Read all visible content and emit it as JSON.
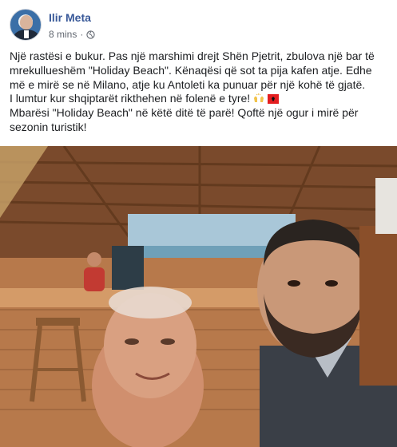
{
  "post": {
    "author": "Ilir Meta",
    "time": "8 mins",
    "separator": "·",
    "privacy_icon": "globe-icon",
    "paragraphs": [
      "Një rastësi e bukur. Pas një marshimi drejt Shën Pjetrit, zbulova një bar të mrekullueshëm \"Holiday Beach\". Kënaqësi që sot ta pija kafen atje. Edhe më e mirë se në Milano, atje ku Antoleti ka punuar për një kohë të gjatë.",
      "I lumtur kur shqiptarët rikthehen në folenë e tyre!",
      "Mbarësi \"Holiday Beach\" në këtë ditë të parë! Qoftë një ogur i mirë për sezonin turistik!"
    ],
    "emojis": [
      "raising-hands-icon",
      "albanian-flag-icon"
    ]
  },
  "photo": {
    "subject": "selfie-photo",
    "colors": {
      "roof": "#8a5a3b",
      "wall": "#c9915f",
      "sky": "#a9c7d8",
      "shirt_dark": "#3a3f47"
    }
  },
  "colors": {
    "author_link": "#385898",
    "meta": "#616770",
    "text": "#1c1e21"
  }
}
